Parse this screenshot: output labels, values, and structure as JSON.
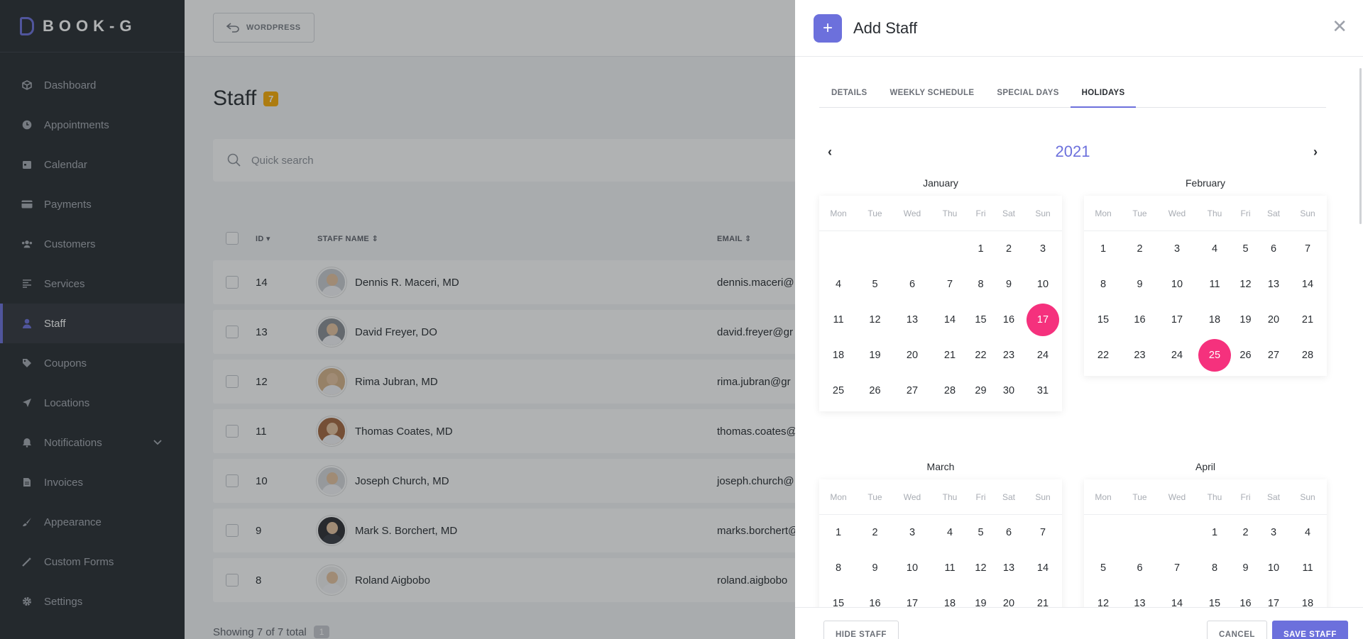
{
  "brand": {
    "name": "BOOK-G",
    "accent": "#6c70dc",
    "holiday_color": "#f5317d"
  },
  "sidebar": {
    "items": [
      {
        "label": "Dashboard",
        "icon": "cube-icon"
      },
      {
        "label": "Appointments",
        "icon": "clock-icon"
      },
      {
        "label": "Calendar",
        "icon": "calendar-icon"
      },
      {
        "label": "Payments",
        "icon": "credit-card-icon"
      },
      {
        "label": "Customers",
        "icon": "users-icon"
      },
      {
        "label": "Services",
        "icon": "list-icon"
      },
      {
        "label": "Staff",
        "icon": "user-icon",
        "active": true
      },
      {
        "label": "Coupons",
        "icon": "tag-icon"
      },
      {
        "label": "Locations",
        "icon": "location-arrow-icon"
      },
      {
        "label": "Notifications",
        "icon": "bell-icon"
      },
      {
        "label": "Invoices",
        "icon": "file-icon"
      },
      {
        "label": "Appearance",
        "icon": "brush-icon"
      },
      {
        "label": "Custom Forms",
        "icon": "magic-wand-icon"
      },
      {
        "label": "Settings",
        "icon": "gear-icon"
      }
    ]
  },
  "topbar": {
    "wordpress_label": "WORDPRESS"
  },
  "page": {
    "title": "Staff",
    "count": "7"
  },
  "search": {
    "placeholder": "Quick search"
  },
  "table": {
    "headers": {
      "id": "ID",
      "name": "STAFF NAME",
      "email": "EMAIL"
    },
    "rows": [
      {
        "id": "14",
        "name": "Dennis R. Maceri, MD",
        "email": "dennis.maceri@"
      },
      {
        "id": "13",
        "name": "David Freyer, DO",
        "email": "david.freyer@gr"
      },
      {
        "id": "12",
        "name": "Rima Jubran, MD",
        "email": "rima.jubran@gr"
      },
      {
        "id": "11",
        "name": "Thomas Coates, MD",
        "email": "thomas.coates@"
      },
      {
        "id": "10",
        "name": "Joseph Church, MD",
        "email": "joseph.church@"
      },
      {
        "id": "9",
        "name": "Mark S. Borchert, MD",
        "email": "marks.borchert@"
      },
      {
        "id": "8",
        "name": "Roland Aigbobo",
        "email": "roland.aigbobo"
      }
    ],
    "footer": "Showing 7 of 7 total",
    "page": "1"
  },
  "panel": {
    "title": "Add Staff",
    "tabs": [
      "DETAILS",
      "WEEKLY SCHEDULE",
      "SPECIAL DAYS",
      "HOLIDAYS"
    ],
    "active_tab": "HOLIDAYS",
    "year": "2021",
    "weekdays": [
      "Mon",
      "Tue",
      "Wed",
      "Thu",
      "Fri",
      "Sat",
      "Sun"
    ],
    "months": [
      {
        "name": "January",
        "offset": 4,
        "days": 31,
        "visible_rows": 5,
        "holidays": [
          17
        ]
      },
      {
        "name": "February",
        "offset": 0,
        "days": 28,
        "visible_rows": 4,
        "holidays": [
          25
        ]
      },
      {
        "name": "March",
        "offset": 0,
        "days": 31,
        "visible_rows": 3,
        "holidays": []
      },
      {
        "name": "April",
        "offset": 3,
        "days": 30,
        "visible_rows": 3,
        "holidays": []
      }
    ],
    "buttons": {
      "hide": "HIDE STAFF",
      "cancel": "CANCEL",
      "save": "SAVE STAFF"
    }
  }
}
